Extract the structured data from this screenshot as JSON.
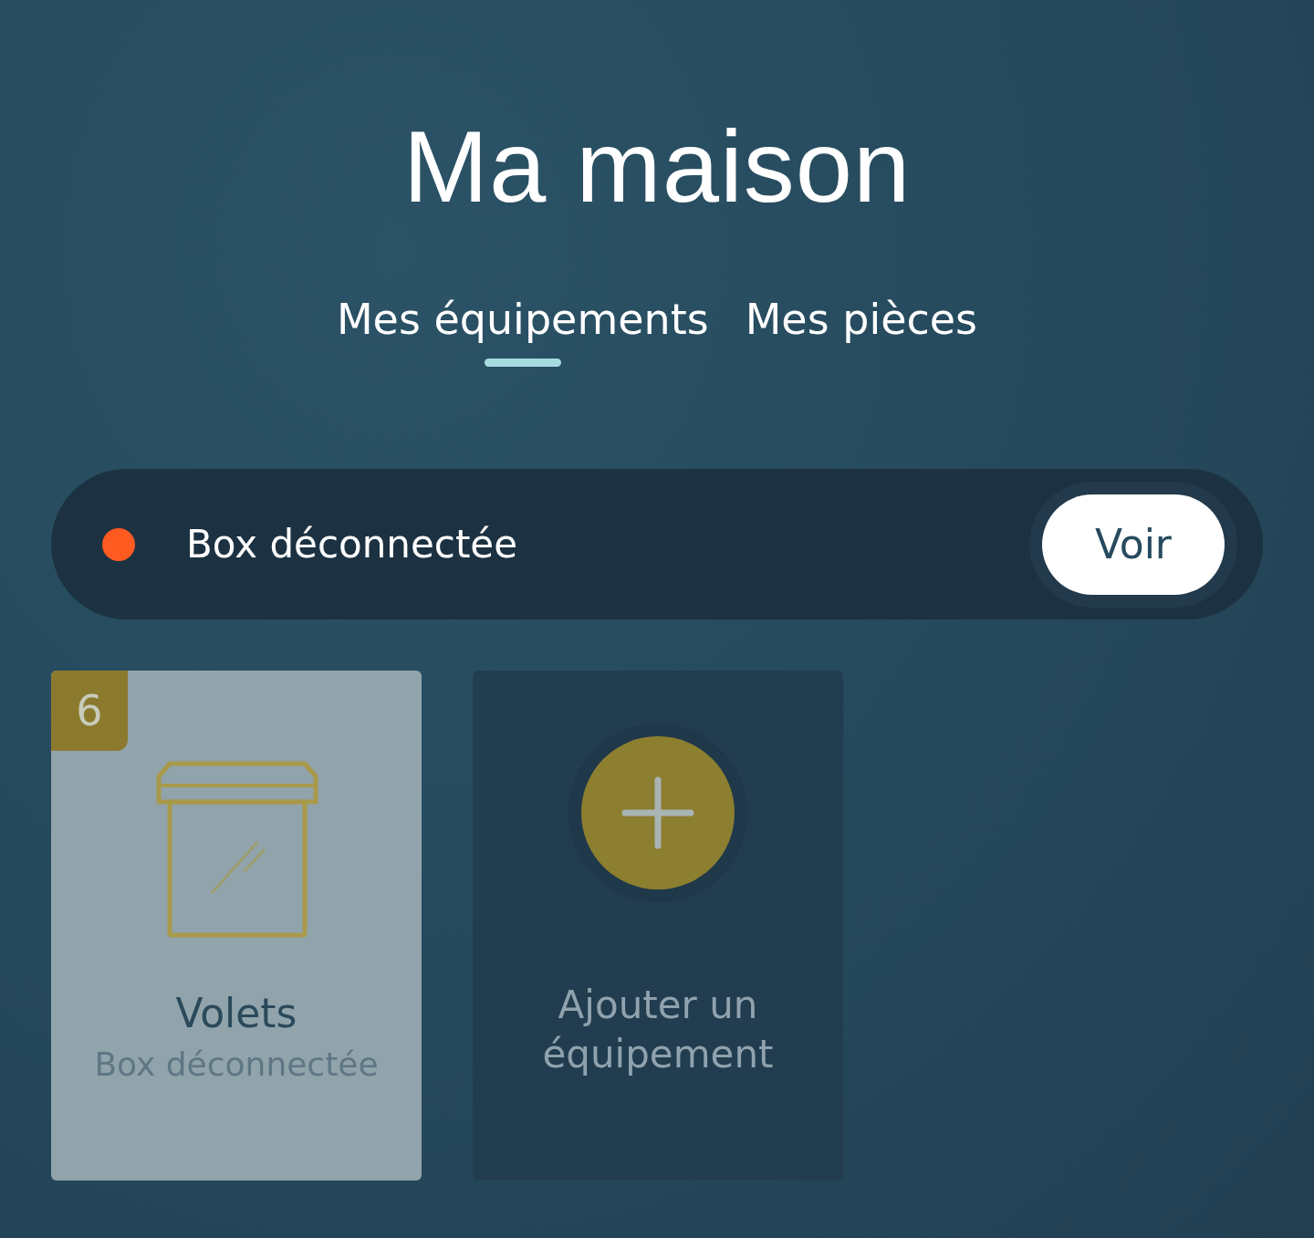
{
  "title": "Ma maison",
  "tabs": [
    {
      "label": "Mes équipements",
      "selected": true
    },
    {
      "label": "Mes pièces",
      "selected": false
    }
  ],
  "alert": {
    "text": "Box déconnectée",
    "button": "Voir"
  },
  "tiles": [
    {
      "kind": "device",
      "count": "6",
      "name": "Volets",
      "status": "Box déconnectée"
    },
    {
      "kind": "add",
      "label": "Ajouter un équipement"
    }
  ]
}
